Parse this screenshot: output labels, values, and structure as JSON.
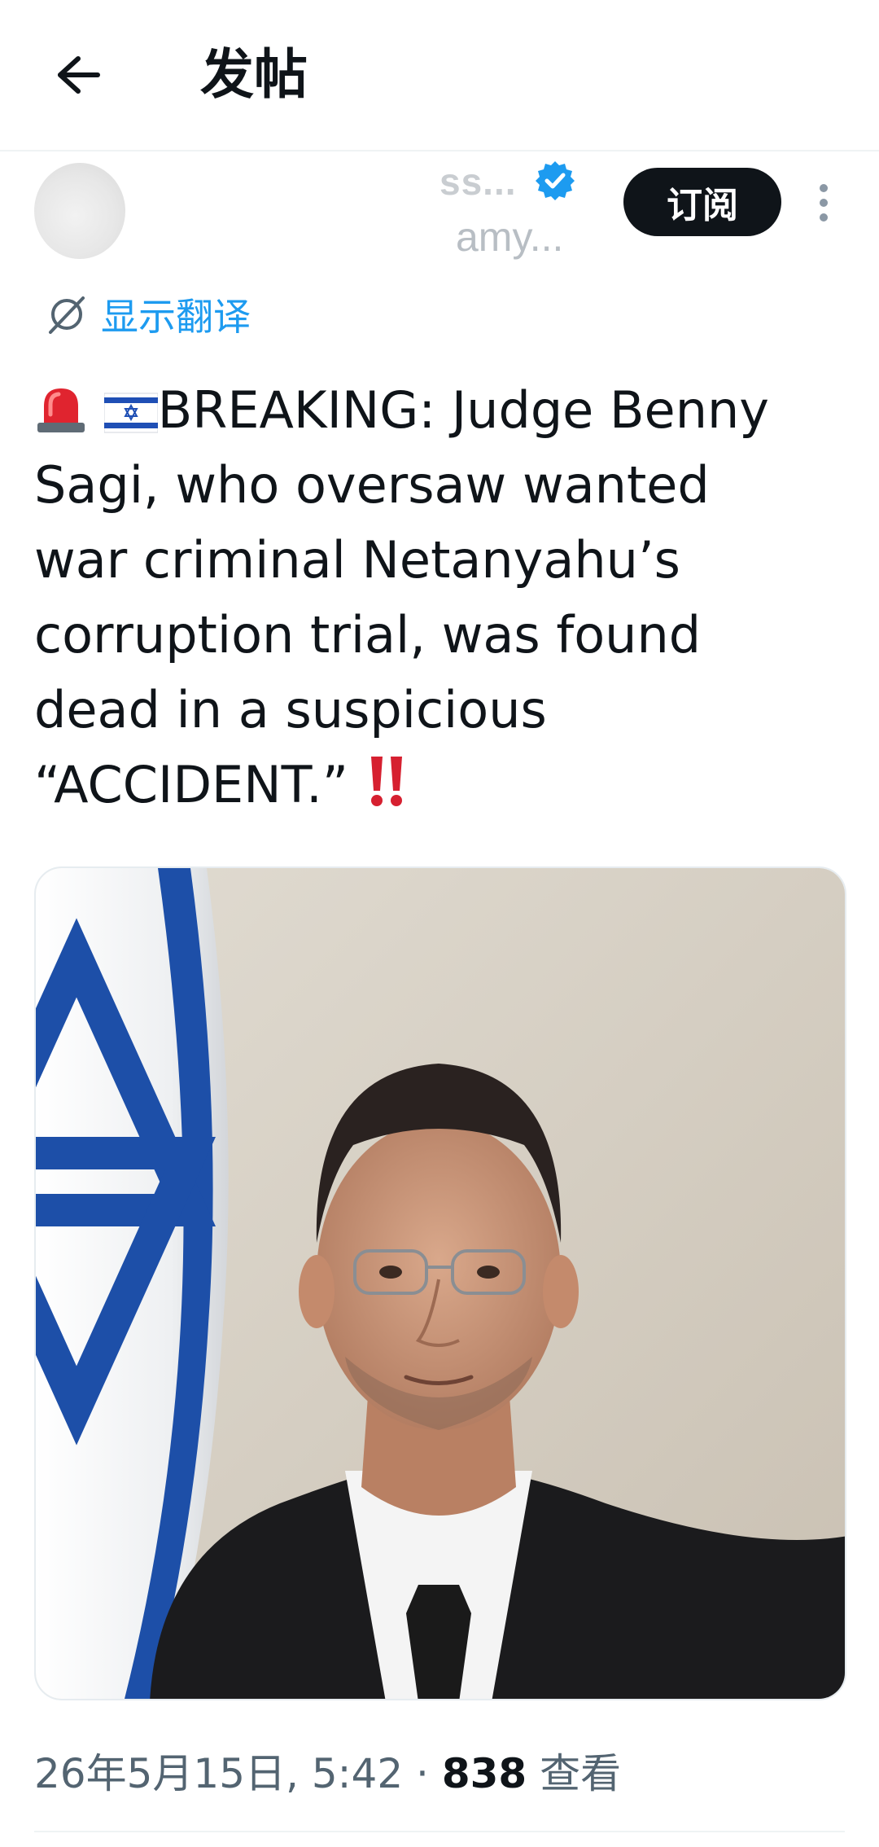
{
  "header": {
    "title": "发帖"
  },
  "author": {
    "name": "ss...",
    "handle": "amy...",
    "verified": true,
    "subscribe_label": "订阅"
  },
  "translate": {
    "label": "显示翻译"
  },
  "tweet": {
    "text_lines": [
      "BREAKING: Judge Benny",
      "Sagi, who oversaw wanted",
      "war criminal Netanyahu’s",
      "corruption trial, was found",
      "dead in a suspicious",
      "“ACCIDENT.”"
    ]
  },
  "meta": {
    "date": "26年5月15日, 5:42",
    "separator": "·",
    "views_count": "838",
    "views_label": "查看"
  },
  "icons": {
    "back": "arrow-left-icon",
    "verified": "verified-badge-icon",
    "more": "more-vertical-icon",
    "translate": "globe-translate-icon",
    "siren": "police-light-icon",
    "flag": "israel-flag-icon",
    "exclaim": "double-exclamation-icon"
  },
  "colors": {
    "accent": "#1d9bf0",
    "text": "#0f1419",
    "secondary": "#536471",
    "button_bg": "#0f1419"
  }
}
